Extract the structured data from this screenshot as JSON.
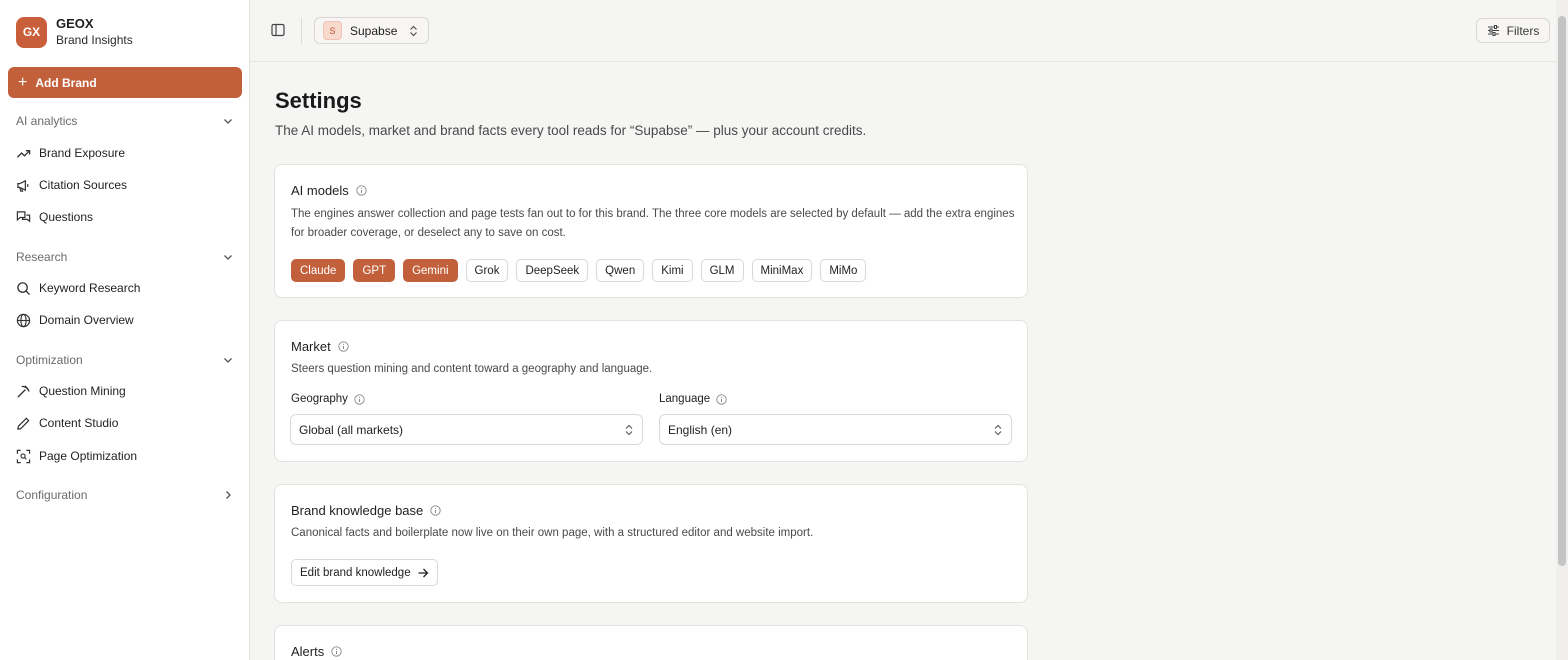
{
  "sidebar": {
    "logo_text": "GX",
    "app_name": "GEOX",
    "app_subtitle": "Brand Insights",
    "add_brand_label": "Add Brand",
    "sections": [
      {
        "label": "AI analytics",
        "items": [
          "Brand Exposure",
          "Citation Sources",
          "Questions"
        ]
      },
      {
        "label": "Research",
        "items": [
          "Keyword Research",
          "Domain Overview"
        ]
      },
      {
        "label": "Optimization",
        "items": [
          "Question Mining",
          "Content Studio",
          "Page Optimization"
        ]
      },
      {
        "label": "Configuration",
        "items": []
      }
    ]
  },
  "topbar": {
    "brand_badge": "S",
    "brand_name": "Supabse",
    "filters_label": "Filters"
  },
  "main": {
    "title": "Settings",
    "subtitle": "The AI models, market and brand facts every tool reads for “Supabse” — plus your account credits."
  },
  "ai_models": {
    "title": "AI models",
    "description": "The engines answer collection and page tests fan out to for this brand. The three core models are selected by default — add the extra engines for broader coverage, or deselect any to save on cost.",
    "models": [
      {
        "label": "Claude",
        "selected": true
      },
      {
        "label": "GPT",
        "selected": true
      },
      {
        "label": "Gemini",
        "selected": true
      },
      {
        "label": "Grok",
        "selected": false
      },
      {
        "label": "DeepSeek",
        "selected": false
      },
      {
        "label": "Qwen",
        "selected": false
      },
      {
        "label": "Kimi",
        "selected": false
      },
      {
        "label": "GLM",
        "selected": false
      },
      {
        "label": "MiniMax",
        "selected": false
      },
      {
        "label": "MiMo",
        "selected": false
      }
    ]
  },
  "market": {
    "title": "Market",
    "description": "Steers question mining and content toward a geography and language.",
    "geography_label": "Geography",
    "geography_value": "Global (all markets)",
    "language_label": "Language",
    "language_value": "English (en)"
  },
  "knowledge": {
    "title": "Brand knowledge base",
    "description": "Canonical facts and boilerplate now live on their own page, with a structured editor and website import.",
    "edit_label": "Edit brand knowledge"
  },
  "alerts": {
    "title": "Alerts"
  },
  "colors": {
    "accent": "#c2603c",
    "background": "#f5f5f4"
  }
}
